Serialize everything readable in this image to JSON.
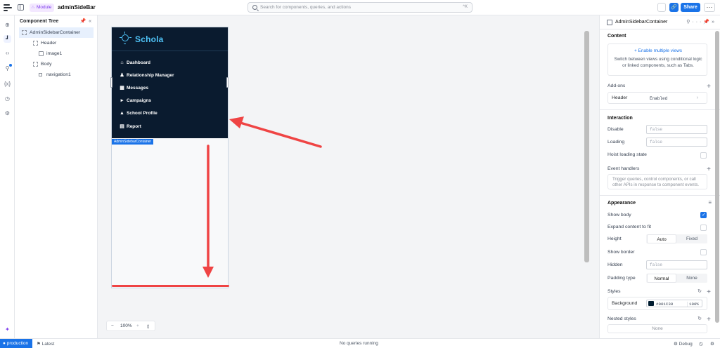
{
  "topbar": {
    "module_label": "Module",
    "app_name": "adminSideBar",
    "search_placeholder": "Search for components, queries, and actions",
    "search_shortcut": "^K",
    "share_label": "Share",
    "more_label": "···"
  },
  "tree": {
    "title": "Component Tree",
    "items": [
      {
        "label": "AdminSidebarContainer"
      },
      {
        "label": "Header"
      },
      {
        "label": "image1"
      },
      {
        "label": "Body"
      },
      {
        "label": "navigation1"
      }
    ]
  },
  "preview": {
    "logo_text": "Schola",
    "nav": [
      {
        "label": "Dashboard",
        "icon": "home-icon"
      },
      {
        "label": "Relationship Manager",
        "icon": "users-icon"
      },
      {
        "label": "Messages",
        "icon": "messages-icon"
      },
      {
        "label": "Campaigns",
        "icon": "megaphone-icon"
      },
      {
        "label": "School Profile",
        "icon": "school-icon"
      },
      {
        "label": "Report",
        "icon": "report-icon"
      }
    ],
    "component_label": "AdminSidebarContainer",
    "sidebar_bg": "#0a1b2f",
    "logo_color": "#4fc3f7",
    "annotation_color": "#ef4444"
  },
  "zoom": {
    "value": "100%"
  },
  "inspector": {
    "title": "AdminSidebarContainer",
    "content": {
      "section": "Content",
      "link": "+ Enable multiple views",
      "desc": "Switch between views using conditional logic or linked components, such as Tabs."
    },
    "addons": {
      "section": "Add-ons",
      "header_label": "Header",
      "header_value": "Enabled"
    },
    "interaction": {
      "section": "Interaction",
      "disable_label": "Disable",
      "disable_placeholder": "false",
      "loading_label": "Loading",
      "loading_placeholder": "false",
      "hoist_label": "Hoist loading state",
      "events_label": "Event handlers",
      "events_desc": "Trigger queries, control components, or call other APIs in response to component events."
    },
    "appearance": {
      "section": "Appearance",
      "show_body_label": "Show body",
      "expand_label": "Expand content to fit",
      "height_label": "Height",
      "height_options": [
        "Auto",
        "Fixed"
      ],
      "height_selected": "Auto",
      "show_border_label": "Show border",
      "hidden_label": "Hidden",
      "hidden_placeholder": "false",
      "padding_label": "Padding type",
      "padding_options": [
        "Normal",
        "None"
      ],
      "padding_selected": "Normal"
    },
    "styles": {
      "section": "Styles",
      "bg_label": "Background",
      "bg_value": "#001C30",
      "bg_opacity": "100%",
      "bg_color": "#001c30"
    },
    "nested_styles": {
      "section": "Nested styles",
      "none_label": "None"
    }
  },
  "status": {
    "env": "production",
    "branch": "Latest",
    "queries": "No queries running",
    "debug": "Debug"
  },
  "accent": "#1a73e8"
}
